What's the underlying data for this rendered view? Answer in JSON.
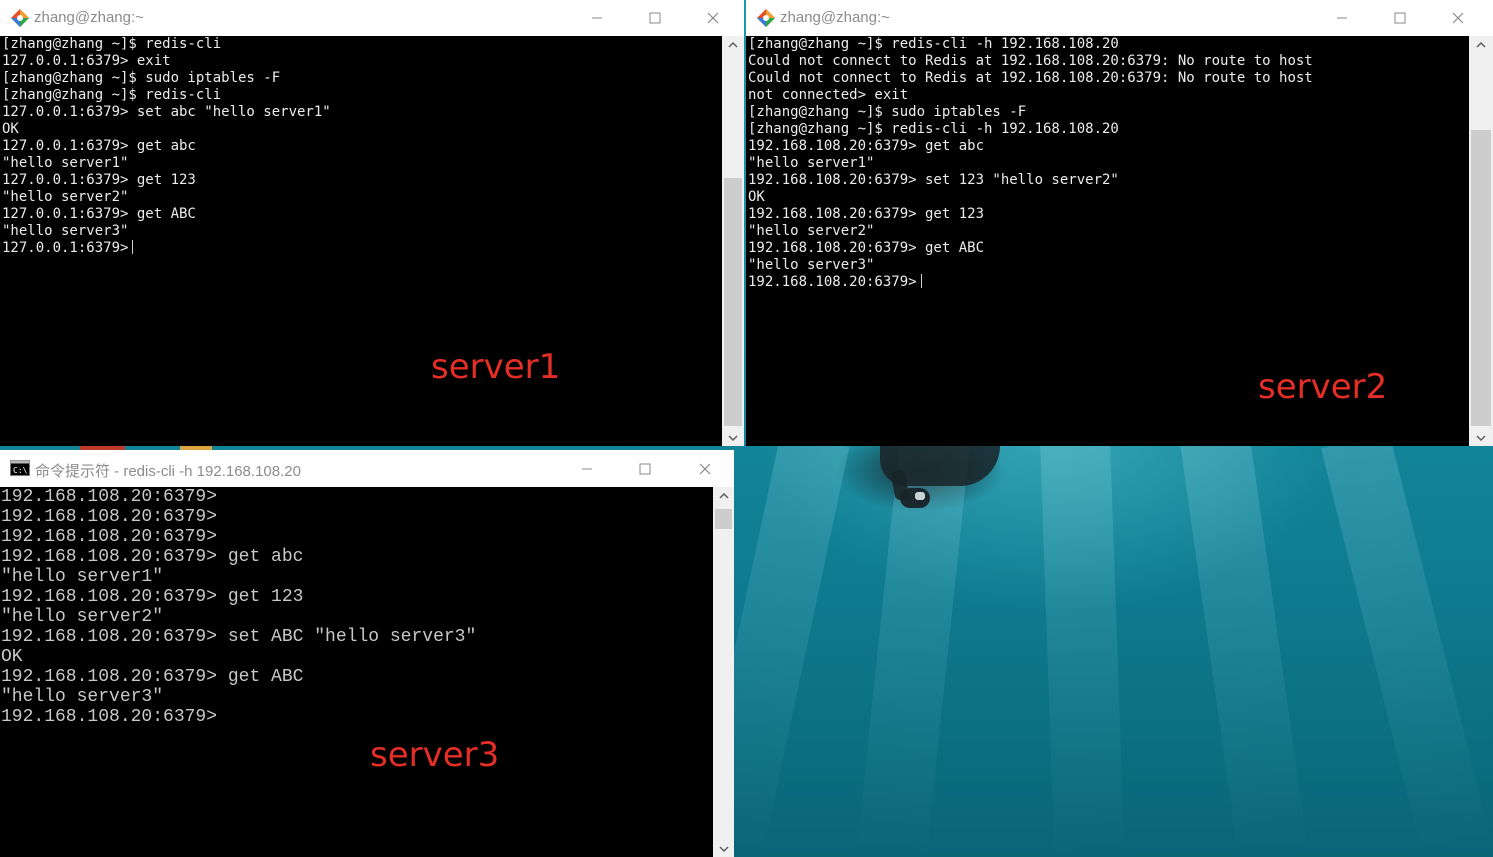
{
  "colors": {
    "annotation_red": "#e52e25",
    "terminal_bg": "#000000",
    "terminal_fg": "#ececec",
    "titlebar_bg": "#ffffff",
    "title_text": "#8c8c8c"
  },
  "icons": {
    "git_icon": "git-bash-diamond-icon",
    "cmd_icon": "command-prompt-icon",
    "minimize": "minimize-icon",
    "maximize": "maximize-icon",
    "close": "close-icon",
    "scroll_up": "chevron-up-icon",
    "scroll_down": "chevron-down-icon"
  },
  "window1": {
    "title": "zhang@zhang:~",
    "annotation": "server1",
    "lines": [
      "[zhang@zhang ~]$ redis-cli",
      "127.0.0.1:6379> exit",
      "[zhang@zhang ~]$ sudo iptables -F",
      "[zhang@zhang ~]$ redis-cli",
      "127.0.0.1:6379> set abc \"hello server1\"",
      "OK",
      "127.0.0.1:6379> get abc",
      "\"hello server1\"",
      "127.0.0.1:6379> get 123",
      "\"hello server2\"",
      "127.0.0.1:6379> get ABC",
      "\"hello server3\"",
      "127.0.0.1:6379>"
    ]
  },
  "window2": {
    "title": "zhang@zhang:~",
    "annotation": "server2",
    "lines": [
      "[zhang@zhang ~]$ redis-cli -h 192.168.108.20",
      "Could not connect to Redis at 192.168.108.20:6379: No route to host",
      "Could not connect to Redis at 192.168.108.20:6379: No route to host",
      "not connected> exit",
      "[zhang@zhang ~]$ sudo iptables -F",
      "[zhang@zhang ~]$ redis-cli -h 192.168.108.20",
      "192.168.108.20:6379> get abc",
      "\"hello server1\"",
      "192.168.108.20:6379> set 123 \"hello server2\"",
      "OK",
      "192.168.108.20:6379> get 123",
      "\"hello server2\"",
      "192.168.108.20:6379> get ABC",
      "\"hello server3\"",
      "192.168.108.20:6379>"
    ]
  },
  "window3": {
    "title": "命令提示符 - redis-cli  -h 192.168.108.20",
    "annotation": "server3",
    "lines": [
      "192.168.108.20:6379>",
      "192.168.108.20:6379>",
      "192.168.108.20:6379>",
      "192.168.108.20:6379> get abc",
      "\"hello server1\"",
      "192.168.108.20:6379> get 123",
      "\"hello server2\"",
      "192.168.108.20:6379> set ABC \"hello server3\"",
      "OK",
      "192.168.108.20:6379> get ABC",
      "\"hello server3\"",
      "192.168.108.20:6379>"
    ]
  }
}
